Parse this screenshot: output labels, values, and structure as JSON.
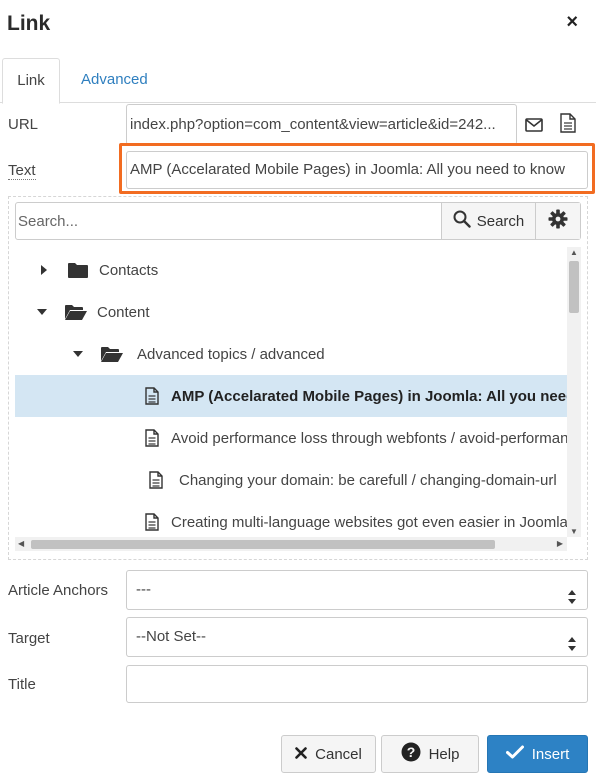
{
  "dialog": {
    "title": "Link",
    "close": "×"
  },
  "tabs": [
    {
      "label": "Link"
    },
    {
      "label": "Advanced"
    }
  ],
  "url": {
    "label": "URL",
    "value": "index.php?option=com_content&view=article&id=242..."
  },
  "text": {
    "label": "Text",
    "value": "AMP (Accelarated Mobile Pages) in Joomla: All you need to know"
  },
  "browser": {
    "search_placeholder": "Search...",
    "search_label": "Search",
    "tree": [
      {
        "label": "Contacts",
        "type": "folder",
        "expanded": false
      },
      {
        "label": "Content",
        "type": "folder",
        "expanded": true
      },
      {
        "label": "Advanced topics / advanced",
        "type": "folder",
        "expanded": true
      },
      {
        "label": "AMP (Accelarated Mobile Pages) in Joomla: All you need to know",
        "type": "article",
        "selected": true
      },
      {
        "label": "Avoid performance loss through webfonts / avoid-performance-loss",
        "type": "article"
      },
      {
        "label": "Changing your domain: be carefull / changing-domain-url",
        "type": "article"
      },
      {
        "label": "Creating multi-language websites got even easier in Joomla",
        "type": "article"
      }
    ]
  },
  "anchors": {
    "label": "Article Anchors",
    "value": "---"
  },
  "target": {
    "label": "Target",
    "value": "--Not Set--"
  },
  "title_field": {
    "label": "Title",
    "value": ""
  },
  "buttons": {
    "cancel": "Cancel",
    "help": "Help",
    "insert": "Insert"
  },
  "colors": {
    "accent": "#2d82c5",
    "highlight": "#f26c21",
    "selected_row": "#d4e6f3",
    "link": "#2f7fbf"
  }
}
